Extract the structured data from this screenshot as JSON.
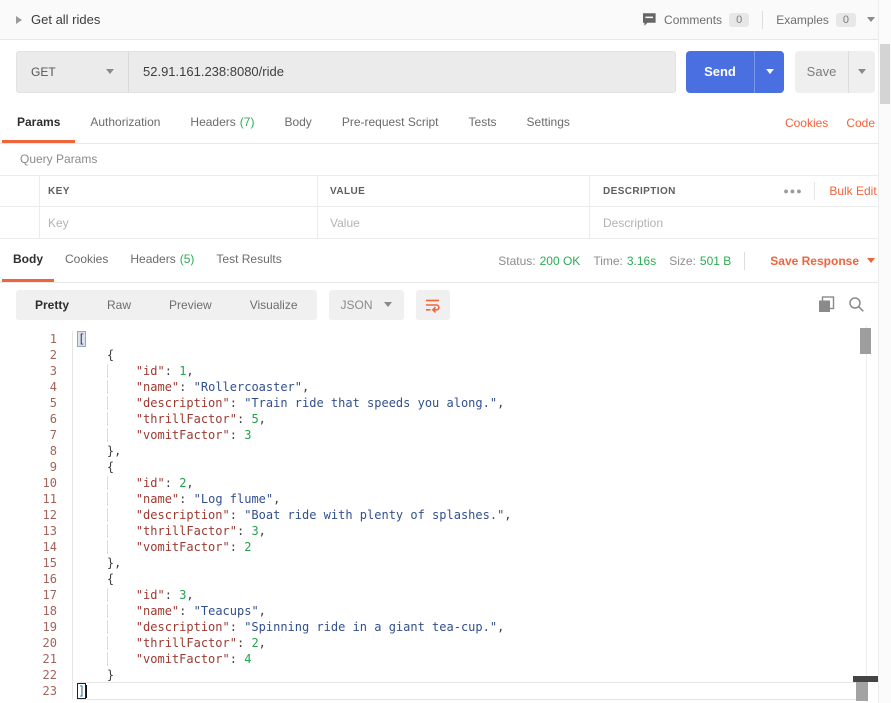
{
  "topbar": {
    "title": "Get all rides",
    "comments_label": "Comments",
    "comments_count": "0",
    "examples_label": "Examples",
    "examples_count": "0"
  },
  "request": {
    "method": "GET",
    "url": "52.91.161.238:8080/ride",
    "send_label": "Send",
    "save_label": "Save"
  },
  "request_tabs": {
    "params": "Params",
    "authorization": "Authorization",
    "headers": "Headers",
    "headers_count": "(7)",
    "body": "Body",
    "prerequest": "Pre-request Script",
    "tests": "Tests",
    "settings": "Settings",
    "cookies_link": "Cookies",
    "code_link": "Code"
  },
  "query_params": {
    "section_label": "Query Params",
    "col_key": "KEY",
    "col_value": "VALUE",
    "col_description": "DESCRIPTION",
    "more_label": "●●●",
    "bulk_edit_label": "Bulk Edit",
    "key_placeholder": "Key",
    "value_placeholder": "Value",
    "description_placeholder": "Description"
  },
  "response": {
    "tab_body": "Body",
    "tab_cookies": "Cookies",
    "tab_headers": "Headers",
    "headers_count": "(5)",
    "tab_test_results": "Test Results",
    "status_label": "Status:",
    "status_value": "200 OK",
    "time_label": "Time:",
    "time_value": "3.16s",
    "size_label": "Size:",
    "size_value": "501 B",
    "save_response_label": "Save Response",
    "view_pretty": "Pretty",
    "view_raw": "Raw",
    "view_preview": "Preview",
    "view_visualize": "Visualize",
    "format": "JSON"
  },
  "editor": {
    "active_line": 23,
    "bracket_match_line": 1,
    "lines": [
      "[",
      "    {",
      "        \"id\": 1,",
      "        \"name\": \"Rollercoaster\",",
      "        \"description\": \"Train ride that speeds you along.\",",
      "        \"thrillFactor\": 5,",
      "        \"vomitFactor\": 3",
      "    },",
      "    {",
      "        \"id\": 2,",
      "        \"name\": \"Log flume\",",
      "        \"description\": \"Boat ride with plenty of splashes.\",",
      "        \"thrillFactor\": 3,",
      "        \"vomitFactor\": 2",
      "    },",
      "    {",
      "        \"id\": 3,",
      "        \"name\": \"Teacups\",",
      "        \"description\": \"Spinning ride in a giant tea-cup.\",",
      "        \"thrillFactor\": 2,",
      "        \"vomitFactor\": 4",
      "    }",
      "]"
    ]
  },
  "colors": {
    "accent_orange": "#f0643c",
    "send_blue": "#4a6fe0",
    "success_green": "#2bac54",
    "code_key": "#9c3a31",
    "code_string": "#32508e",
    "code_number": "#23a14d",
    "line_number_color": "#a5625a"
  }
}
